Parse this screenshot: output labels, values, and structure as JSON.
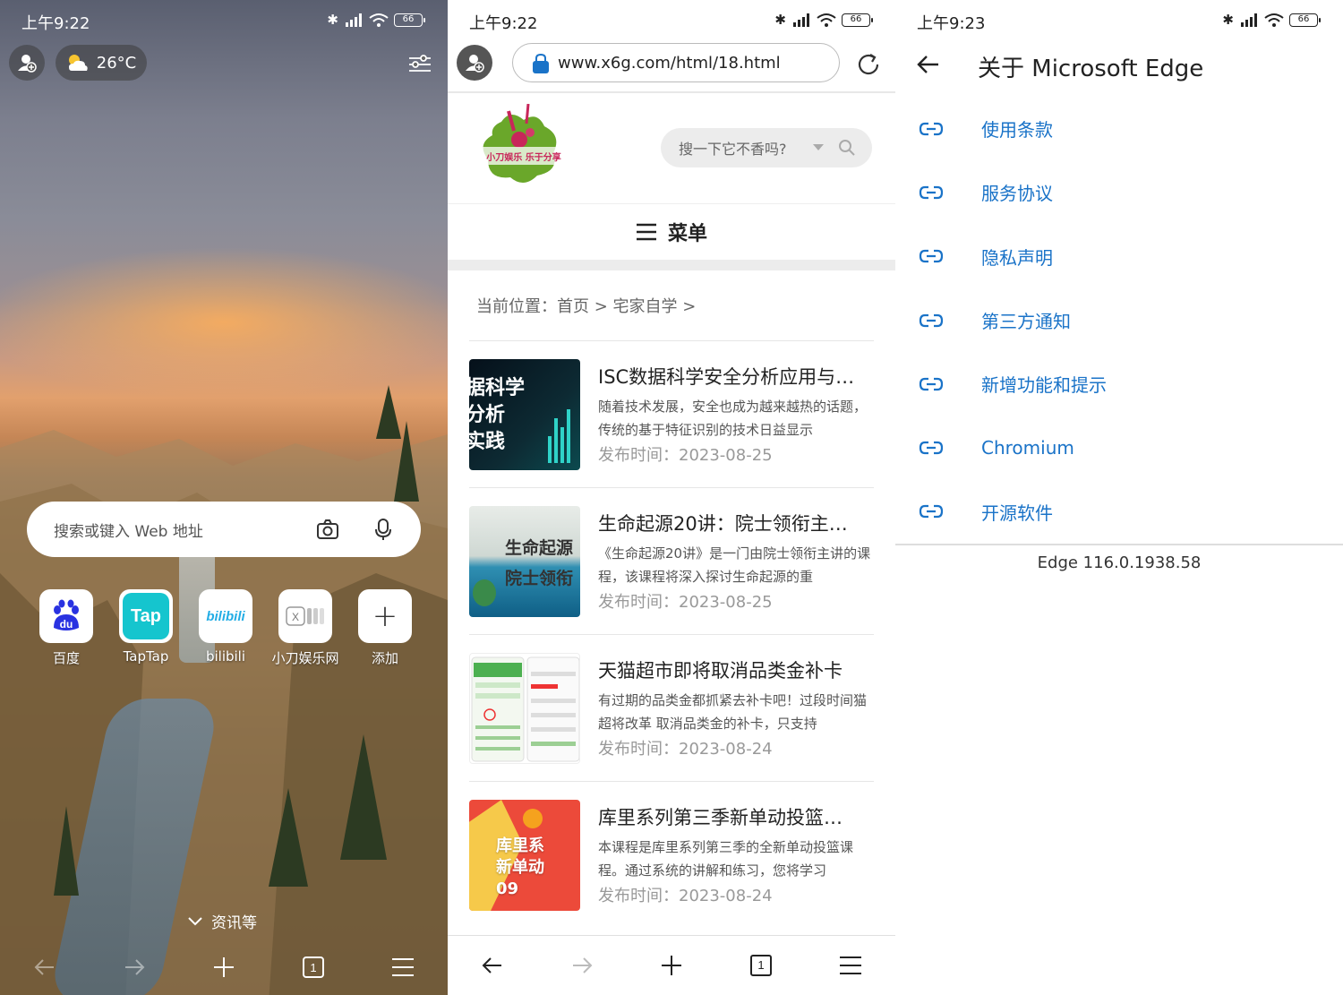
{
  "status_bars": [
    {
      "time": "上午9:22",
      "battery": "66"
    },
    {
      "time": "上午9:22",
      "battery": "66"
    },
    {
      "time": "上午9:23",
      "battery": "66"
    }
  ],
  "new_tab": {
    "weather": {
      "temperature": "26°C",
      "icon": "partly-cloudy-icon"
    },
    "search_placeholder": "搜索或键入 Web 地址",
    "quick_links": [
      {
        "label": "百度",
        "icon_text": "du"
      },
      {
        "label": "TapTap",
        "icon_text": "Tap"
      },
      {
        "label": "bilibili",
        "icon_text": "bilibili"
      },
      {
        "label": "小刀娱乐网",
        "icon_text": "X"
      },
      {
        "label": "添加",
        "icon_text": "+"
      }
    ],
    "feed_label": "资讯等"
  },
  "browser": {
    "url": "www.x6g.com/html/18.html",
    "logo_text": "小刀娱乐 乐于分享",
    "site_search_placeholder": "搜一下它不香吗?",
    "menu_label": "菜单",
    "breadcrumb": "当前位置：首页 > 宅家自学 >",
    "articles": [
      {
        "title": "ISC数据科学安全分析应用与…",
        "desc": "随着技术发展，安全也成为越来越热的话题，传统的基于特征识别的技术日益显示",
        "date": "发布时间：2023-08-25",
        "thumb_text": "据科学\n分析\n实践"
      },
      {
        "title": "生命起源20讲：院士领衔主…",
        "desc": "《生命起源20讲》是一门由院士领衔主讲的课程，该课程将深入探讨生命起源的重",
        "date": "发布时间：2023-08-25",
        "thumb_text": "生命起源\n院士领衔"
      },
      {
        "title": "天猫超市即将取消品类金补卡",
        "desc": "有过期的品类金都抓紧去补卡吧！过段时间猫超将改革 取消品类金的补卡，只支持",
        "date": "发布时间：2023-08-24",
        "thumb_text": ""
      },
      {
        "title": "库里系列第三季新单动投篮…",
        "desc": "本课程是库里系列第三季的全新单动投篮课程。通过系统的讲解和练习，您将学习",
        "date": "发布时间：2023-08-24",
        "thumb_text": "库里系\n新单动\n09"
      }
    ],
    "tab_count": "1"
  },
  "about": {
    "title": "关于 Microsoft Edge",
    "links": [
      "使用条款",
      "服务协议",
      "隐私声明",
      "第三方通知",
      "新增功能和提示",
      "Chromium",
      "开源软件"
    ],
    "version": "Edge 116.0.1938.58"
  },
  "colors": {
    "link_blue": "#1a73c8",
    "bilibili_blue": "#23ade5",
    "taptap_cyan": "#15c5ce",
    "baidu_blue": "#2932e1"
  }
}
